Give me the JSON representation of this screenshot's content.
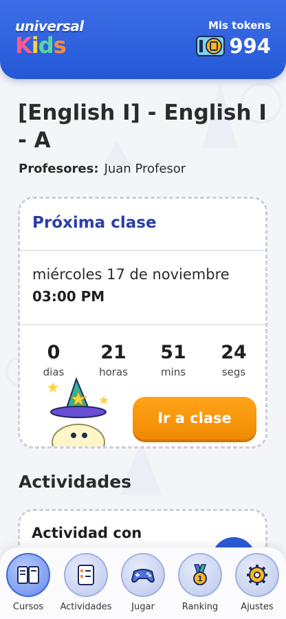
{
  "header": {
    "logo_top": "universal",
    "logo_bottom": [
      "K",
      "i",
      "d",
      "s"
    ],
    "tokens_label": "Mis tokens",
    "tokens_value": "994",
    "token_icon": "coin-ticket-icon"
  },
  "course": {
    "title": "[English I] - English I - A",
    "teachers_label": "Profesores:",
    "teachers_value": "Juan Profesor"
  },
  "next_class": {
    "title": "Próxima clase",
    "date": "miércoles 17 de noviembre",
    "time": "03:00 PM",
    "countdown": [
      {
        "value": "0",
        "label": "dias"
      },
      {
        "value": "21",
        "label": "horas"
      },
      {
        "value": "51",
        "label": "mins"
      },
      {
        "value": "24",
        "label": "segs"
      }
    ],
    "button_label": "Ir a clase"
  },
  "activities": {
    "heading": "Actividades",
    "card_title": "Actividad con"
  },
  "bottom_nav": [
    {
      "label": "Cursos",
      "icon": "book-icon",
      "active": true
    },
    {
      "label": "Actividades",
      "icon": "checklist-icon",
      "active": false
    },
    {
      "label": "Jugar",
      "icon": "gamepad-icon",
      "active": false
    },
    {
      "label": "Ranking",
      "icon": "medal-icon",
      "active": false
    },
    {
      "label": "Ajustes",
      "icon": "gear-icon",
      "active": false
    }
  ],
  "colors": {
    "header_blue": "#2458d6",
    "accent_orange": "#f08a00",
    "title_blue": "#2a3fa6"
  }
}
